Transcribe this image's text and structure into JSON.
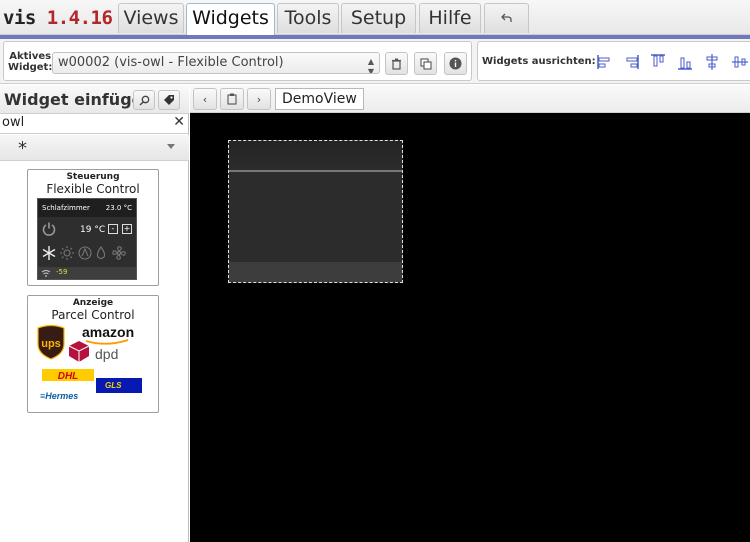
{
  "app": {
    "name": "vis",
    "version": "1.4.16"
  },
  "menu": {
    "tabs": [
      {
        "label": "Views"
      },
      {
        "label": "Widgets"
      },
      {
        "label": "Tools"
      },
      {
        "label": "Setup"
      },
      {
        "label": "Hilfe"
      }
    ],
    "undo_icon": "undo-icon"
  },
  "toolbar": {
    "active_widget_label": "Aktives\nWidget:",
    "active_widget_value": "w00002 (vis-owl - Flexible Control)",
    "align_label": "Widgets ausrichten:"
  },
  "widget_panel": {
    "title": "Widget einfügen",
    "filter_value": "owl",
    "set_value": "*",
    "cards": [
      {
        "category": "Steuerung",
        "name": "Flexible Control",
        "preview": {
          "room": "Schlafzimmer",
          "temperature": "23.0 °C",
          "setpoint": "19 °C",
          "minus": "-",
          "plus": "+",
          "rssi": "-59"
        }
      },
      {
        "category": "Anzeige",
        "name": "Parcel Control",
        "logos": [
          "UPS",
          "amazon",
          "dpd",
          "DHL",
          "GLS",
          "Hermes"
        ]
      }
    ]
  },
  "editor": {
    "view_name": "DemoView"
  },
  "colors": {
    "brand_version": "#b3262a",
    "accent_line": "#6f78bd",
    "canvas": "#000000"
  }
}
